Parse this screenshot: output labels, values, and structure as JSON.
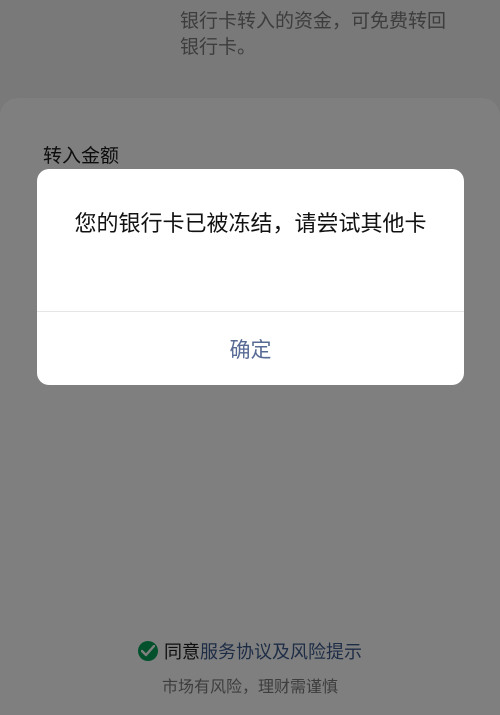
{
  "page": {
    "top_info": "银行卡转入的资金，可免费转回银行卡。",
    "amount_label": "转入金额",
    "agreement": {
      "prefix": "同意",
      "link_text": "服务协议及风险提示"
    },
    "risk_note": "市场有风险，理财需谨慎"
  },
  "dialog": {
    "message": "您的银行卡已被冻结，请尝试其他卡",
    "confirm_label": "确定"
  },
  "colors": {
    "link": "#576b95",
    "check": "#07a05a",
    "mask": "rgba(0,0,0,0.5)"
  },
  "icons": {
    "check": "check-circle-icon"
  }
}
